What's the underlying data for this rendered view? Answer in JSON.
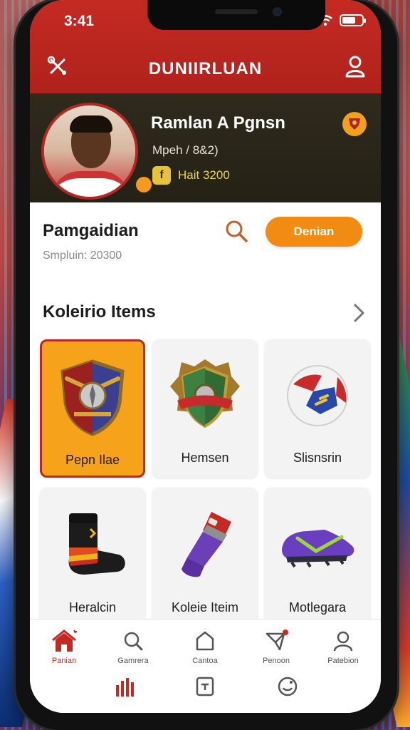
{
  "status_bar": {
    "time": "3:41"
  },
  "header": {
    "title": "DUNIIRLUAN"
  },
  "profile": {
    "name": "Ramlan A Pgnsn",
    "subtitle": "Mpeh / 8&2)",
    "stat": "Hait 3200",
    "stat_icon_glyph": "f"
  },
  "section": {
    "title": "Pamgaidian",
    "subtitle": "Smpluin: 20300",
    "cta_label": "Denian"
  },
  "collection": {
    "title": "Koleirio Items",
    "items": [
      {
        "label": "Pepn Ilae",
        "icon": "crest-shield-icon",
        "selected": true
      },
      {
        "label": "Hemsen",
        "icon": "badge-shield-icon",
        "selected": false
      },
      {
        "label": "Slisnsrin",
        "icon": "soccer-ball-icon",
        "selected": false
      },
      {
        "label": "Heralcin",
        "icon": "sock-icon",
        "selected": false
      },
      {
        "label": "Koleie Iteim",
        "icon": "trophy-cannon-icon",
        "selected": false
      },
      {
        "label": "Motlegara",
        "icon": "football-boot-icon",
        "selected": false
      }
    ]
  },
  "bottom_nav": {
    "items": [
      {
        "label": "Panian",
        "icon": "home-icon",
        "active": true
      },
      {
        "label": "Gamrera",
        "icon": "search-icon",
        "active": false
      },
      {
        "label": "Cantoa",
        "icon": "shop-icon",
        "active": false
      },
      {
        "label": "Penoon",
        "icon": "send-icon",
        "active": false
      },
      {
        "label": "Patebion",
        "icon": "profile-icon",
        "active": false
      }
    ],
    "secondary": [
      {
        "icon": "chart-icon"
      },
      {
        "icon": "square-icon"
      },
      {
        "icon": "smile-icon"
      }
    ]
  },
  "colors": {
    "header": "#c42a22",
    "profile_band": "#2a2519",
    "accent": "#f28b12",
    "selected_card": "#f7a21b"
  }
}
